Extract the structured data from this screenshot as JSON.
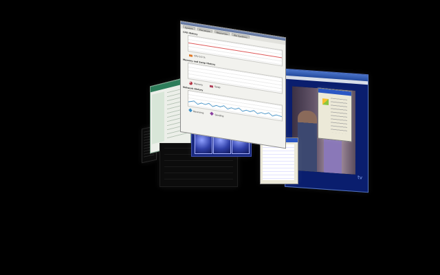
{
  "desktop": {
    "background": "#000000",
    "effect": "3D desktop cube switcher"
  },
  "monitor_window": {
    "tabs": [
      "System",
      "Processes",
      "Resources",
      "File Systems"
    ],
    "sections": [
      {
        "title": "CPU History",
        "y_ticks": [
          "100 %",
          "50 %",
          "0 %"
        ],
        "legend": [
          "CPU 0.0 %"
        ]
      },
      {
        "title": "Memory and Swap History",
        "y_ticks": [
          "100 %",
          "50 %",
          "0 %"
        ],
        "legend": [
          "Memory",
          "Swap"
        ]
      },
      {
        "title": "Network History",
        "y_ticks": [
          "4.0 KiB/s",
          "2.0 KiB/s",
          "0 bytes/s"
        ],
        "legend": [
          "Receiving",
          "Sending"
        ]
      }
    ],
    "colors": {
      "cpu": "#e07a2a",
      "memory": "#b03040",
      "swap": "#b0405a",
      "receiving": "#3a8fc8",
      "sending": "#8a3fa0"
    }
  },
  "video_window": {
    "logo_text": "tv"
  },
  "icons": {
    "file_dialog": "folder-icon",
    "properties": "color-swatch-icon"
  }
}
